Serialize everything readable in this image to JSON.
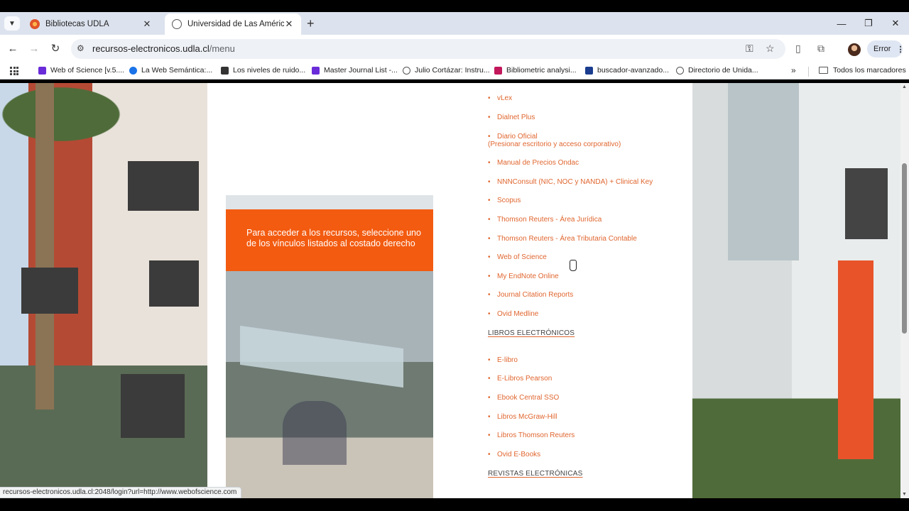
{
  "browser": {
    "tabs": [
      {
        "title": "Bibliotecas UDLA",
        "active": false
      },
      {
        "title": "Universidad de Las Américas",
        "active": true
      }
    ],
    "new_tab": "+",
    "window_controls": {
      "minimize": "—",
      "maximize": "❐",
      "close": "✕"
    },
    "url_host": "recursos-electronicos.udla.cl",
    "url_path": "/menu",
    "profile_status": "Error",
    "bookmarks": [
      {
        "label": "Web of Science [v.5....",
        "color": "#6a2bd9"
      },
      {
        "label": "La Web Semántica:...",
        "color": "#1a73e8"
      },
      {
        "label": "Los niveles de ruido...",
        "color": "#333333"
      },
      {
        "label": "Master Journal List -...",
        "color": "#6a2bd9"
      },
      {
        "label": "Julio Cortázar: Instru...",
        "color": "#555555"
      },
      {
        "label": "Bibliometric analysi...",
        "color": "#c2185b"
      },
      {
        "label": "buscador-avanzado...",
        "color": "#1a3d8f"
      },
      {
        "label": "Directorio de Unida...",
        "color": "#555555"
      }
    ],
    "bookmarks_more": "»",
    "all_bookmarks": "Todos los marcadores",
    "status_url": "recursos-electronicos.udla.cl:2048/login?url=http://www.webofscience.com"
  },
  "page": {
    "promo_text": "Para acceder a los recursos, seleccione uno de los vínculos listados al costado derecho",
    "databases": [
      {
        "label": "vLex"
      },
      {
        "label": "Dialnet Plus"
      },
      {
        "label": "Diario Oficial"
      },
      {
        "label": "Manual de Precios Ondac"
      },
      {
        "label": "NNNConsult (NIC, NOC y NANDA) + Clinical Key"
      },
      {
        "label": "Scopus"
      },
      {
        "label": "Thomson Reuters - Área Jurídica"
      },
      {
        "label": "Thomson Reuters - Área Tributaria Contable"
      },
      {
        "label": "Web of Science"
      },
      {
        "label": "My EndNote Online"
      },
      {
        "label": "Journal Citation Reports"
      },
      {
        "label": "Ovid Medline"
      }
    ],
    "diario_note": "(Presionar escritorio y acceso corporativo)",
    "heading_ebooks": "LIBROS ELECTRÓNICOS",
    "ebooks": [
      {
        "label": "E-libro"
      },
      {
        "label": "E-Libros Pearson"
      },
      {
        "label": "Ebook Central SSO"
      },
      {
        "label": "Libros McGraw-Hill"
      },
      {
        "label": "Libros Thomson Reuters"
      },
      {
        "label": "Ovid E-Books"
      }
    ],
    "heading_journals": "REVISTAS ELECTRÓNICAS",
    "bullet": "•"
  }
}
